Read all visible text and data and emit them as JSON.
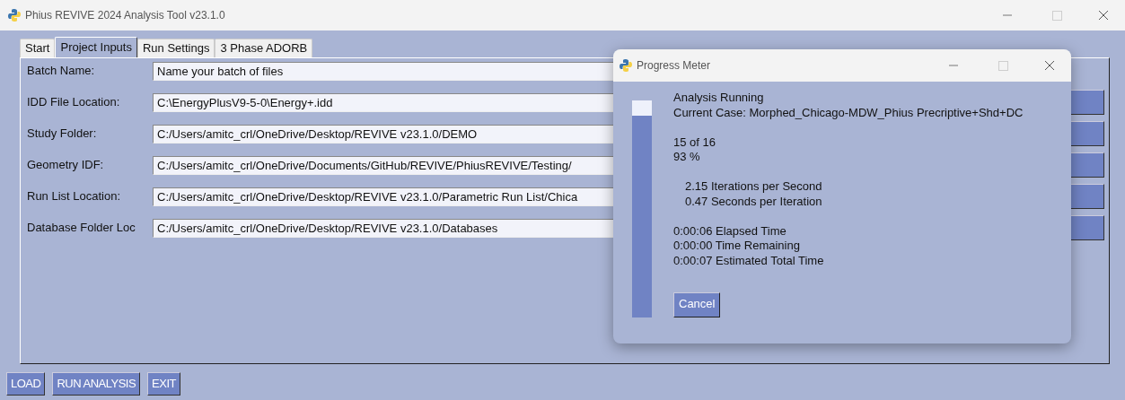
{
  "window": {
    "title": "Phius REVIVE 2024 Analysis Tool v23.1.0"
  },
  "tabs": [
    {
      "label": "Start",
      "selected": false
    },
    {
      "label": "Project Inputs",
      "selected": true
    },
    {
      "label": "Run Settings",
      "selected": false
    },
    {
      "label": "3 Phase ADORB",
      "selected": false
    }
  ],
  "fields": [
    {
      "label": "Batch Name:",
      "value": "Name your batch of files",
      "browse": false
    },
    {
      "label": "IDD File Location:",
      "value": "C:\\EnergyPlusV9-5-0\\Energy+.idd",
      "browse": true
    },
    {
      "label": "Study Folder:",
      "value": "C:/Users/amitc_crl/OneDrive/Desktop/REVIVE v23.1.0/DEMO",
      "browse": true
    },
    {
      "label": "Geometry IDF:",
      "value": "C:/Users/amitc_crl/OneDrive/Documents/GitHub/REVIVE/PhiusREVIVE/Testing/",
      "browse": true
    },
    {
      "label": "Run List Location:",
      "value": "C:/Users/amitc_crl/OneDrive/Desktop/REVIVE v23.1.0/Parametric Run List/Chica",
      "browse": true
    },
    {
      "label": "Database Folder Loc",
      "value": "C:/Users/amitc_crl/OneDrive/Desktop/REVIVE v23.1.0/Databases",
      "browse": true
    }
  ],
  "buttons": [
    "LOAD",
    "RUN ANALYSIS",
    "EXIT"
  ],
  "dialog": {
    "title": "Progress Meter",
    "level": 0.93,
    "groups": [
      {
        "indent": false,
        "lines": [
          "Analysis Running",
          "Current Case: Morphed_Chicago-MDW_Phius Precriptive+Shd+DC"
        ]
      },
      {
        "indent": false,
        "lines": [
          "15 of 16",
          "93 %"
        ]
      },
      {
        "indent": true,
        "lines": [
          "2.15 Iterations per Second",
          "0.47 Seconds per Iteration"
        ]
      },
      {
        "indent": false,
        "lines": [
          "0:00:06 Elapsed Time",
          "0:00:00 Time Remaining",
          "0:00:07 Estimated Total Time"
        ]
      }
    ],
    "cancel": "Cancel"
  }
}
